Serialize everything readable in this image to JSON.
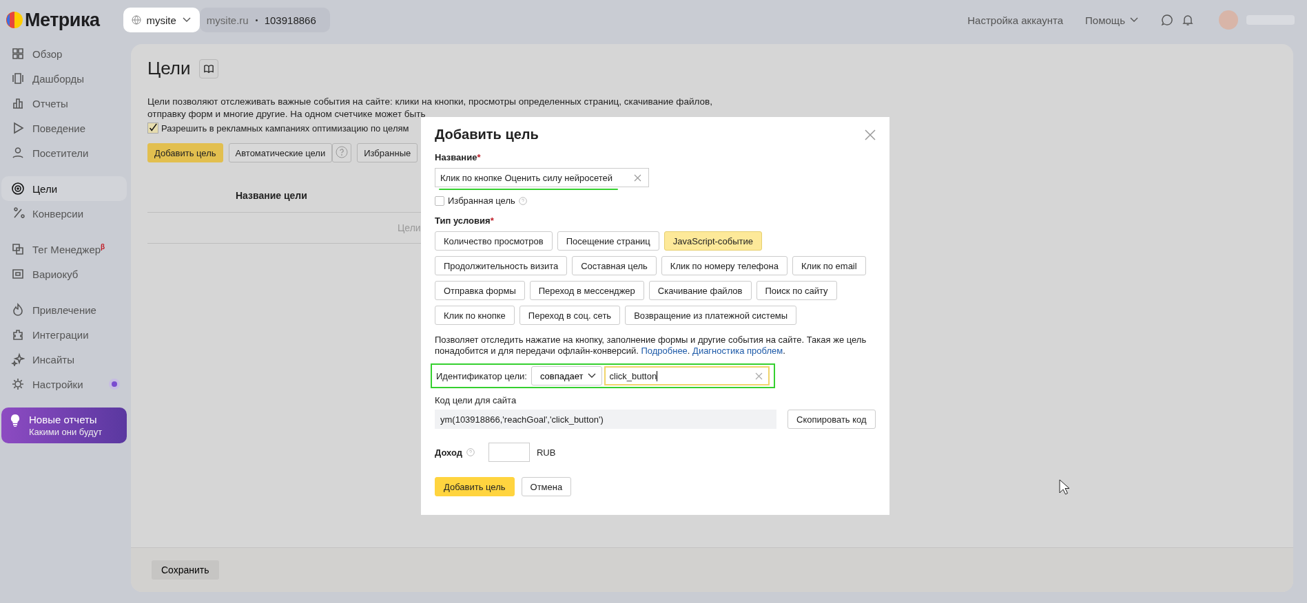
{
  "header": {
    "logo": "Метрика",
    "site_selector": "mysite",
    "site_domain": "mysite.ru",
    "counter_id": "103918866",
    "links": [
      "Настройка аккаунта",
      "Помощь"
    ]
  },
  "sidebar": {
    "groups": [
      [
        {
          "label": "Обзор",
          "selected": false
        },
        {
          "label": "Дашборды",
          "selected": false
        },
        {
          "label": "Отчеты",
          "selected": false
        },
        {
          "label": "Поведение",
          "selected": false
        },
        {
          "label": "Посетители",
          "selected": false
        }
      ],
      [
        {
          "label": "Цели",
          "selected": true
        },
        {
          "label": "Конверсии",
          "selected": false
        }
      ],
      [
        {
          "label": "Тег Менеджер",
          "selected": false,
          "badge": "β"
        },
        {
          "label": "Вариокуб",
          "selected": false
        }
      ],
      [
        {
          "label": "Привлечение",
          "selected": false
        },
        {
          "label": "Интеграции",
          "selected": false
        },
        {
          "label": "Инсайты",
          "selected": false
        },
        {
          "label": "Настройки",
          "selected": false,
          "new_dot": true
        }
      ]
    ],
    "promo": {
      "title": "Новые отчеты",
      "subtitle": "Какими они будут"
    }
  },
  "page": {
    "title": "Цели",
    "description": [
      "Цели позволяют отслеживать важные события на сайте: клики на кнопки, просмотры определенных страниц, скачивание файлов,",
      "отправку форм и многие другие. На одном счетчике может быть"
    ],
    "ads_optimization": {
      "label": "Разрешить в рекламных кампаниях оптимизацию по целям",
      "checked": true
    },
    "buttons": [
      "Добавить цель",
      "Автоматические цели",
      "Избранные"
    ],
    "table": {
      "column": "Название цели",
      "empty_text": "Цели"
    },
    "save_button": "Сохранить"
  },
  "dialog": {
    "title": "Добавить цель",
    "name_label": "Название",
    "name_value": "Клик по кнопке Оценить силу нейросетей",
    "favorite": {
      "label": "Избранная цель",
      "checked": false
    },
    "condition_label": "Тип условия",
    "condition_types": [
      {
        "label": "Количество просмотров",
        "selected": false
      },
      {
        "label": "Посещение страниц",
        "selected": false
      },
      {
        "label": "JavaScript-событие",
        "selected": true
      },
      {
        "label": "Продолжительность визита",
        "selected": false
      },
      {
        "label": "Составная цель",
        "selected": false
      },
      {
        "label": "Клик по номеру телефона",
        "selected": false
      },
      {
        "label": "Клик по email",
        "selected": false
      },
      {
        "label": "Отправка формы",
        "selected": false
      },
      {
        "label": "Переход в мессенджер",
        "selected": false
      },
      {
        "label": "Скачивание файлов",
        "selected": false
      },
      {
        "label": "Поиск по сайту",
        "selected": false
      },
      {
        "label": "Клик по кнопке",
        "selected": false
      },
      {
        "label": "Переход в соц. сеть",
        "selected": false
      },
      {
        "label": "Возвращение из платежной системы",
        "selected": false
      }
    ],
    "hint": "Позволяет отследить нажатие на кнопку, заполнение формы и другие события на сайте. Такая же цель понадобится и для передачи офлайн-конверсий.",
    "hint_links": [
      "Подробнее",
      "Диагностика проблем"
    ],
    "hint_punctuation": [
      ".",
      "."
    ],
    "required_mark": "*",
    "identifier_label": "Идентификатор цели:",
    "match_mode": "совпадает",
    "identifier_value": "click_button",
    "code_label": "Код цели для сайта",
    "code": "ym(103918866,'reachGoal','click_button')",
    "copy_button": "Скопировать код",
    "income_label": "Доход",
    "currency": "RUB",
    "submit": "Добавить цель",
    "cancel": "Отмена"
  }
}
